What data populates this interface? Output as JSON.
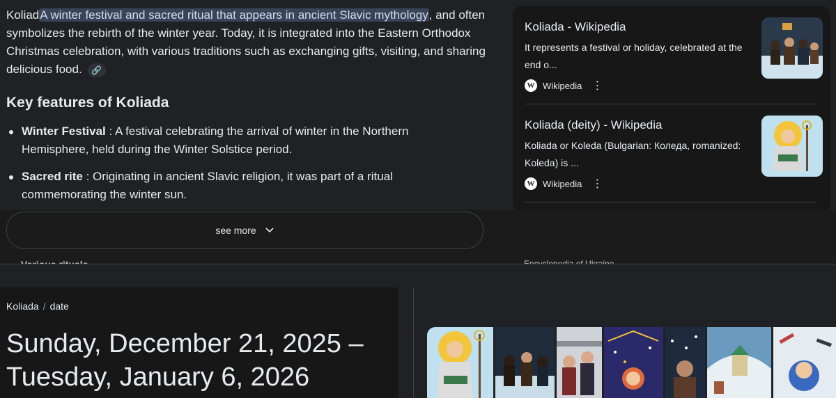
{
  "overview": {
    "intro_prefix": "Koliad",
    "intro_highlight": "A winter festival and sacred ritual that appears in ancient Slavic mythology",
    "intro_rest": ", and often symbolizes the rebirth of the winter year. Today, it is integrated into the Eastern Orthodox Christmas celebration, with various traditions such as exchanging gifts, visiting, and sharing delicious food.",
    "link_icon": "link-icon",
    "heading": "Key features of Koliada",
    "bullets": [
      {
        "term": "Winter Festival",
        "text": " : A festival celebrating the arrival of winter in the Northern Hemisphere, held during the Winter Solstice period."
      },
      {
        "term": "Sacred rite",
        "text": " : Originating in ancient Slavic religion, it was part of a ritual commemorating the winter sun."
      }
    ],
    "peek_text": "Various rituals",
    "see_more_label": "see more"
  },
  "sources": [
    {
      "title": "Koliada - Wikipedia",
      "snippet": "It represents a festival or holiday, celebrated at the end o...",
      "site": "Wikipedia",
      "icon": "wikipedia-icon"
    },
    {
      "title": "Koliada (deity) - Wikipedia",
      "snippet": "Koliada or Koleda (Bulgarian: Коледа, romanized: Koleda) is ...",
      "site": "Wikipedia",
      "icon": "wikipedia-icon"
    }
  ],
  "sources_peek": "Encyclopedia of Ukraine",
  "date_card": {
    "breadcrumb": [
      "Koliada",
      "date"
    ],
    "date_text": "Sunday, December 21, 2025 – Tuesday, January 6, 2026"
  },
  "colors": {
    "background": "#202124",
    "panel": "#171717",
    "highlight": "#394457",
    "text": "#e8eaed"
  }
}
